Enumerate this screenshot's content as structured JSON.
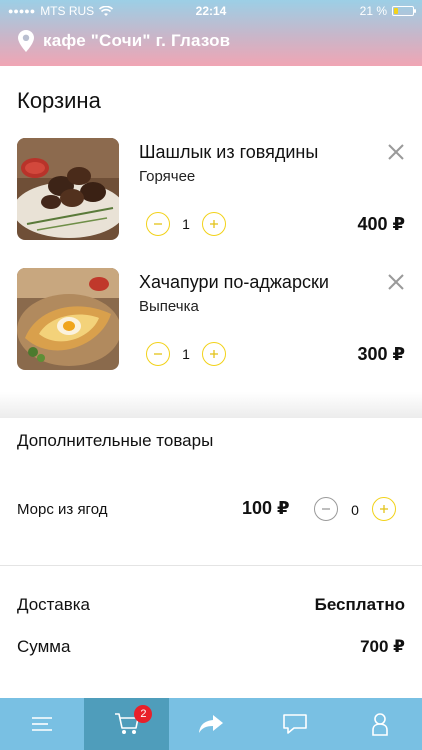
{
  "status_bar": {
    "carrier": "MTS RUS",
    "time": "22:14",
    "battery": "21 %",
    "battery_level": 0.21
  },
  "header": {
    "title": "кафе \"Сочи\" г. Глазов"
  },
  "cart": {
    "title": "Корзина",
    "items": [
      {
        "name": "Шашлык из говядины",
        "category": "Горячее",
        "quantity": "1",
        "price": "400 ₽"
      },
      {
        "name": "Хачапури по-аджарски",
        "category": "Выпечка",
        "quantity": "1",
        "price": "300 ₽"
      }
    ]
  },
  "extras": {
    "title": "Дополнительные товары",
    "items": [
      {
        "name": "Морс из ягод",
        "price": "100 ₽",
        "quantity": "0"
      }
    ]
  },
  "summary": {
    "delivery_label": "Доставка",
    "delivery_value": "Бесплатно",
    "total_label": "Сумма",
    "total_value": "700 ₽"
  },
  "tabbar": {
    "cart_badge": "2"
  },
  "colors": {
    "accent_yellow": "#f2d21a",
    "tabbar": "#79c0e3",
    "tabbar_active": "#4f9dbb",
    "badge": "#e8202a"
  }
}
